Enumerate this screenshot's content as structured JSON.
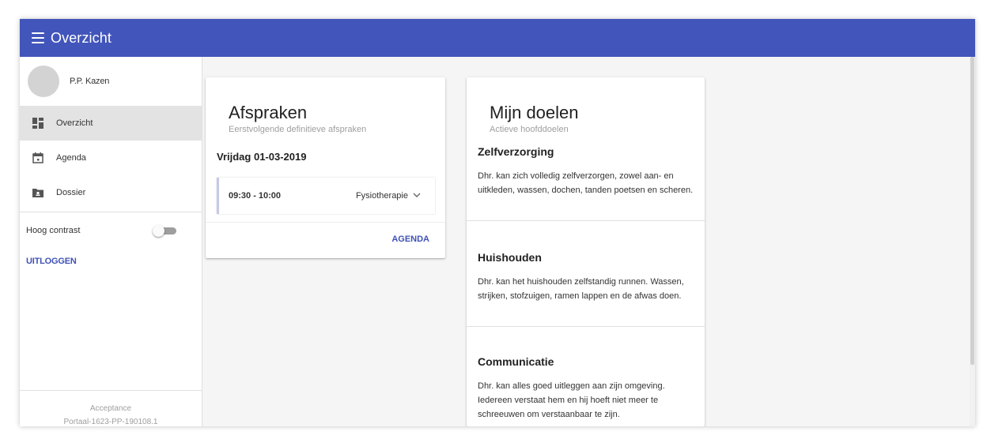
{
  "appbar": {
    "title": "Overzicht",
    "color": "#4255bb"
  },
  "sidebar": {
    "user_name": "P.P. Kazen",
    "items": [
      {
        "label": "Overzicht",
        "icon": "dashboard-icon",
        "active": true
      },
      {
        "label": "Agenda",
        "icon": "calendar-icon",
        "active": false
      },
      {
        "label": "Dossier",
        "icon": "folder-icon",
        "active": false
      }
    ],
    "contrast_label": "Hoog contrast",
    "contrast_on": false,
    "logout_label": "UITLOGGEN",
    "footer": {
      "env": "Acceptance",
      "build": "Portaal-1623-PP-190108.1"
    }
  },
  "appointments": {
    "title": "Afspraken",
    "subtitle": "Eerstvolgende definitieve afspraken",
    "date": "Vrijdag 01-03-2019",
    "items": [
      {
        "time": "09:30 - 10:00",
        "type": "Fysiotherapie"
      }
    ],
    "link_label": "AGENDA"
  },
  "goals": {
    "title": "Mijn doelen",
    "subtitle": "Actieve hoofddoelen",
    "items": [
      {
        "title": "Zelfverzorging",
        "text": "Dhr. kan zich volledig zelfverzorgen, zowel aan- en uitkleden, wassen, dochen, tanden poetsen en scheren."
      },
      {
        "title": "Huishouden",
        "text": "Dhr. kan het huishouden zelfstandig runnen. Wassen, strijken, stofzuigen, ramen lappen en de afwas doen."
      },
      {
        "title": "Communicatie",
        "text": "Dhr. kan alles goed uitleggen aan zijn omgeving. Iedereen verstaat hem en hij hoeft niet meer te schreeuwen om verstaanbaar te zijn."
      }
    ]
  },
  "accent_color": "#3f51b5"
}
